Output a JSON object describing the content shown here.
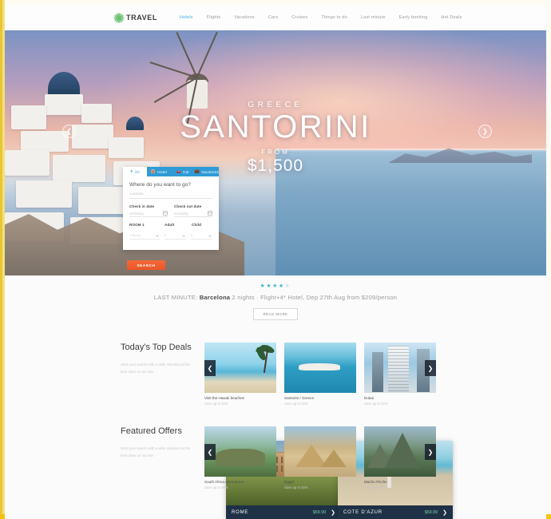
{
  "header": {
    "logo_text": "TRAVEL",
    "nav": [
      {
        "label": "Hotels",
        "active": true
      },
      {
        "label": "Flights",
        "active": false
      },
      {
        "label": "Vacations",
        "active": false
      },
      {
        "label": "Cars",
        "active": false
      },
      {
        "label": "Cruises",
        "active": false
      },
      {
        "label": "Things to do",
        "active": false
      },
      {
        "label": "Last minute",
        "active": false
      },
      {
        "label": "Early booking",
        "active": false
      },
      {
        "label": "Hot Deals",
        "active": false
      }
    ]
  },
  "hero": {
    "country": "GREECE",
    "title": "SANTORINI",
    "from_label": "FROM",
    "price": "$1,500",
    "prev_icon": "chevron-left-icon",
    "next_icon": "chevron-right-icon"
  },
  "search": {
    "tabs": [
      {
        "label": "Air",
        "icon": "plane-icon",
        "active": true
      },
      {
        "label": "Hotel",
        "icon": "bed-icon",
        "active": false
      },
      {
        "label": "Car",
        "icon": "car-icon",
        "active": false
      },
      {
        "label": "Vacations",
        "icon": "suitcase-icon",
        "active": false
      }
    ],
    "heading": "Where do you want to go?",
    "destination_placeholder": "Location",
    "checkin_label": "Check in date",
    "checkin_placeholder": "mm/dd/yy",
    "checkout_label": "Check out date",
    "checkout_placeholder": "mm/dd/yy",
    "room_label": "ROOM 1",
    "room_value": "1 Room",
    "adult_label": "Adult",
    "adult_value": "2",
    "child_label": "Child",
    "child_value": "0",
    "search_button": "SEARCH"
  },
  "promos": [
    {
      "name": "ROME",
      "price": "$59.99",
      "chevron": "chevron-right-icon"
    },
    {
      "name": "COTE D'AZUR",
      "price": "$59.99",
      "chevron": "chevron-right-icon"
    }
  ],
  "lastminute": {
    "stars_filled": 4,
    "stars_total": 5,
    "prefix": "LAST MINUTE:",
    "destination": "Barcelona",
    "details": "2 nights · Flight+4* Hotel, Dep 27th Aug from $209/person",
    "read_more": "READ MORE"
  },
  "sections": [
    {
      "title": "Today's Top Deals",
      "subtitle": "Start your search with a wide selection at the best rates on our site",
      "prev_icon": "chevron-left-icon",
      "next_icon": "chevron-right-icon",
      "cards": [
        {
          "name": "Visit the Hawaii beaches",
          "save": "Save up to 30%",
          "art": "img-beach"
        },
        {
          "name": "Santorini / Greece",
          "save": "Save up to 30%",
          "art": "img-santorini"
        },
        {
          "name": "Dubai",
          "save": "Save up to 30%",
          "art": "img-dubai"
        }
      ]
    },
    {
      "title": "Featured Offers",
      "subtitle": "Start your search with a wide selection at the best rates on our site",
      "prev_icon": "chevron-left-icon",
      "next_icon": "chevron-right-icon",
      "cards": [
        {
          "name": "South Africa Adventures",
          "save": "Save up to 30%",
          "art": "img-safari"
        },
        {
          "name": "Egypt",
          "save": "Save up to 30%",
          "art": "img-egypt"
        },
        {
          "name": "Machu Picchu",
          "save": "Save up to 30%",
          "art": "img-machu"
        }
      ]
    }
  ],
  "colors": {
    "frame": "#f1c40f",
    "accent_blue": "#2e9bd6",
    "accent_orange": "#ec5626",
    "promo_bar": "#1e3146",
    "price_green": "#7fd3a8",
    "star": "#3fb6c9"
  }
}
